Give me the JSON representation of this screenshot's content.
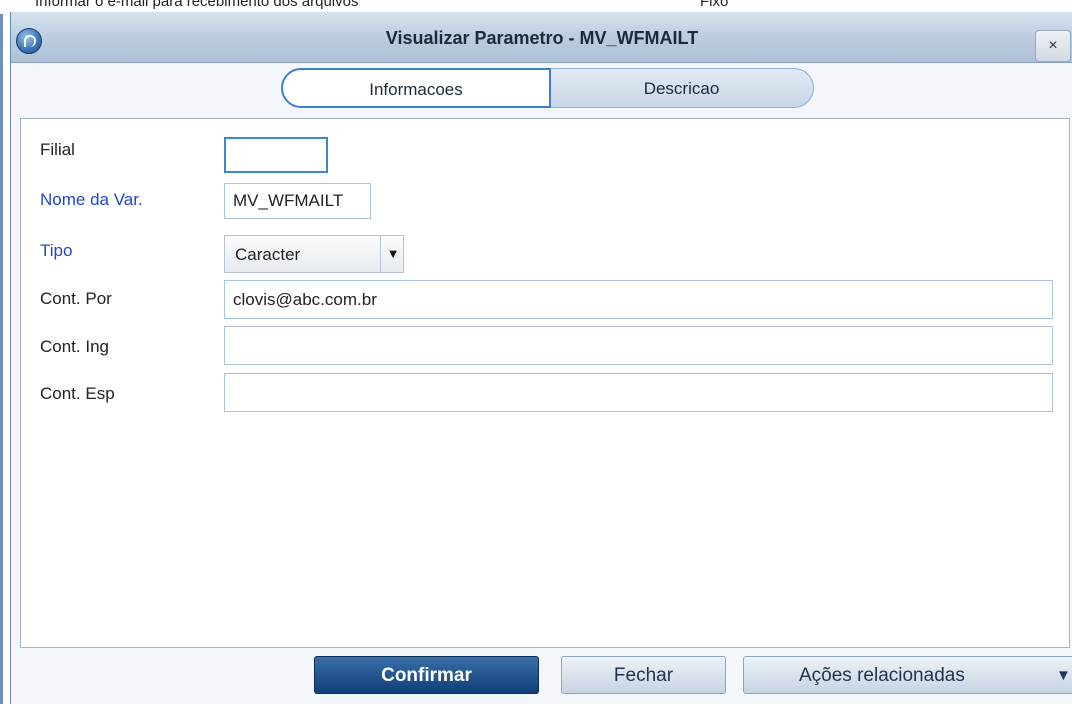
{
  "background": {
    "text_left": "Informar o e-mail para recebimento dos arquivos",
    "text_right": "Fixo"
  },
  "window": {
    "title": "Visualizar Parametro - MV_WFMAILT",
    "close_label": "×"
  },
  "tabs": [
    {
      "label": "Informacoes",
      "active": true
    },
    {
      "label": "Descricao",
      "active": false
    }
  ],
  "form": {
    "filial": {
      "label": "Filial",
      "value": ""
    },
    "nome_var": {
      "label": "Nome da Var.",
      "value": "MV_WFMAILT"
    },
    "tipo": {
      "label": "Tipo",
      "value": "Caracter"
    },
    "cont_por": {
      "label": "Cont. Por",
      "value": "clovis@abc.com.br"
    },
    "cont_ing": {
      "label": "Cont. Ing",
      "value": ""
    },
    "cont_esp": {
      "label": "Cont. Esp",
      "value": ""
    }
  },
  "footer": {
    "confirm": "Confirmar",
    "close": "Fechar",
    "actions": "Ações relacionadas"
  },
  "colors": {
    "required_label": "#2244cc",
    "primary_button": "#0f3f78",
    "active_tab_border": "#3e7fd1"
  },
  "icons": {
    "app_logo": "app-logo-icon",
    "close": "close-icon",
    "dropdown": "chevron-down-icon"
  }
}
